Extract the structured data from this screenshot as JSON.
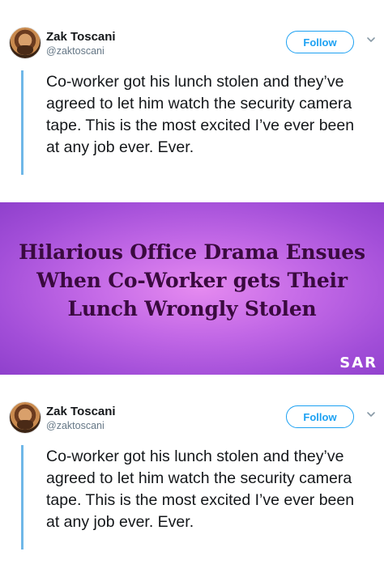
{
  "tweets": [
    {
      "name": "Zak Toscani",
      "handle": "@zaktoscani",
      "follow_label": "Follow",
      "text": "Co-worker got his lunch stolen and they’ve agreed to let him watch the security camera tape. This is the most excited I’ve ever been at any job ever. Ever."
    },
    {
      "name": "Zak Toscani",
      "handle": "@zaktoscani",
      "follow_label": "Follow",
      "text": "Co-worker got his lunch stolen and they’ve agreed to let him watch the security camera tape. This is the most excited I’ve ever been at any job ever. Ever."
    }
  ],
  "banner": {
    "headline": "Hilarious Office Drama Ensues When Co-Worker gets Their Lunch Wrongly Stolen",
    "logo": "SAR"
  },
  "colors": {
    "accent": "#1da1f2",
    "quote_bar": "#6fb7e8",
    "banner_center": "#e58af0",
    "banner_edge": "#8f40cc",
    "headline": "#3a0a3f"
  },
  "icons": [
    "avatar",
    "chevron-down-icon"
  ]
}
